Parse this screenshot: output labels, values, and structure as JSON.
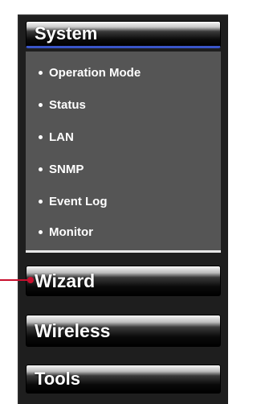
{
  "menu": {
    "system": {
      "label": "System"
    },
    "system_items": [
      {
        "label": "Operation Mode"
      },
      {
        "label": "Status"
      },
      {
        "label": "LAN"
      },
      {
        "label": "SNMP"
      },
      {
        "label": "Event Log"
      },
      {
        "label": "Monitor"
      }
    ],
    "wizard": {
      "label": "Wizard"
    },
    "wireless": {
      "label": "Wireless"
    },
    "tools": {
      "label": "Tools"
    }
  },
  "annotation": {
    "pointer_color": "#c8102e",
    "target": "Wizard"
  },
  "colors": {
    "system_underline": "#3a55c8",
    "submenu_bg": "#555555",
    "panel_bg": "#1e1e1e"
  }
}
